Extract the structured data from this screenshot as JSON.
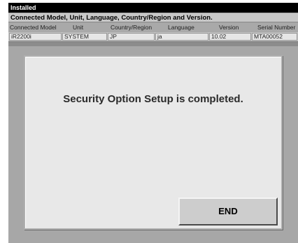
{
  "window": {
    "title": "Installed"
  },
  "info": {
    "header": "Connected Model, Unit, Language, Country/Region and Version."
  },
  "table": {
    "columns": [
      "Connected Model",
      "Unit",
      "Country/Region",
      "Language",
      "Version",
      "Serial Number"
    ],
    "row": [
      "iR2200i",
      "SYSTEM",
      "JP",
      "ja",
      "10.02",
      "MTA00052"
    ]
  },
  "dialog": {
    "message": "Security Option Setup is completed.",
    "end_label": "END"
  }
}
